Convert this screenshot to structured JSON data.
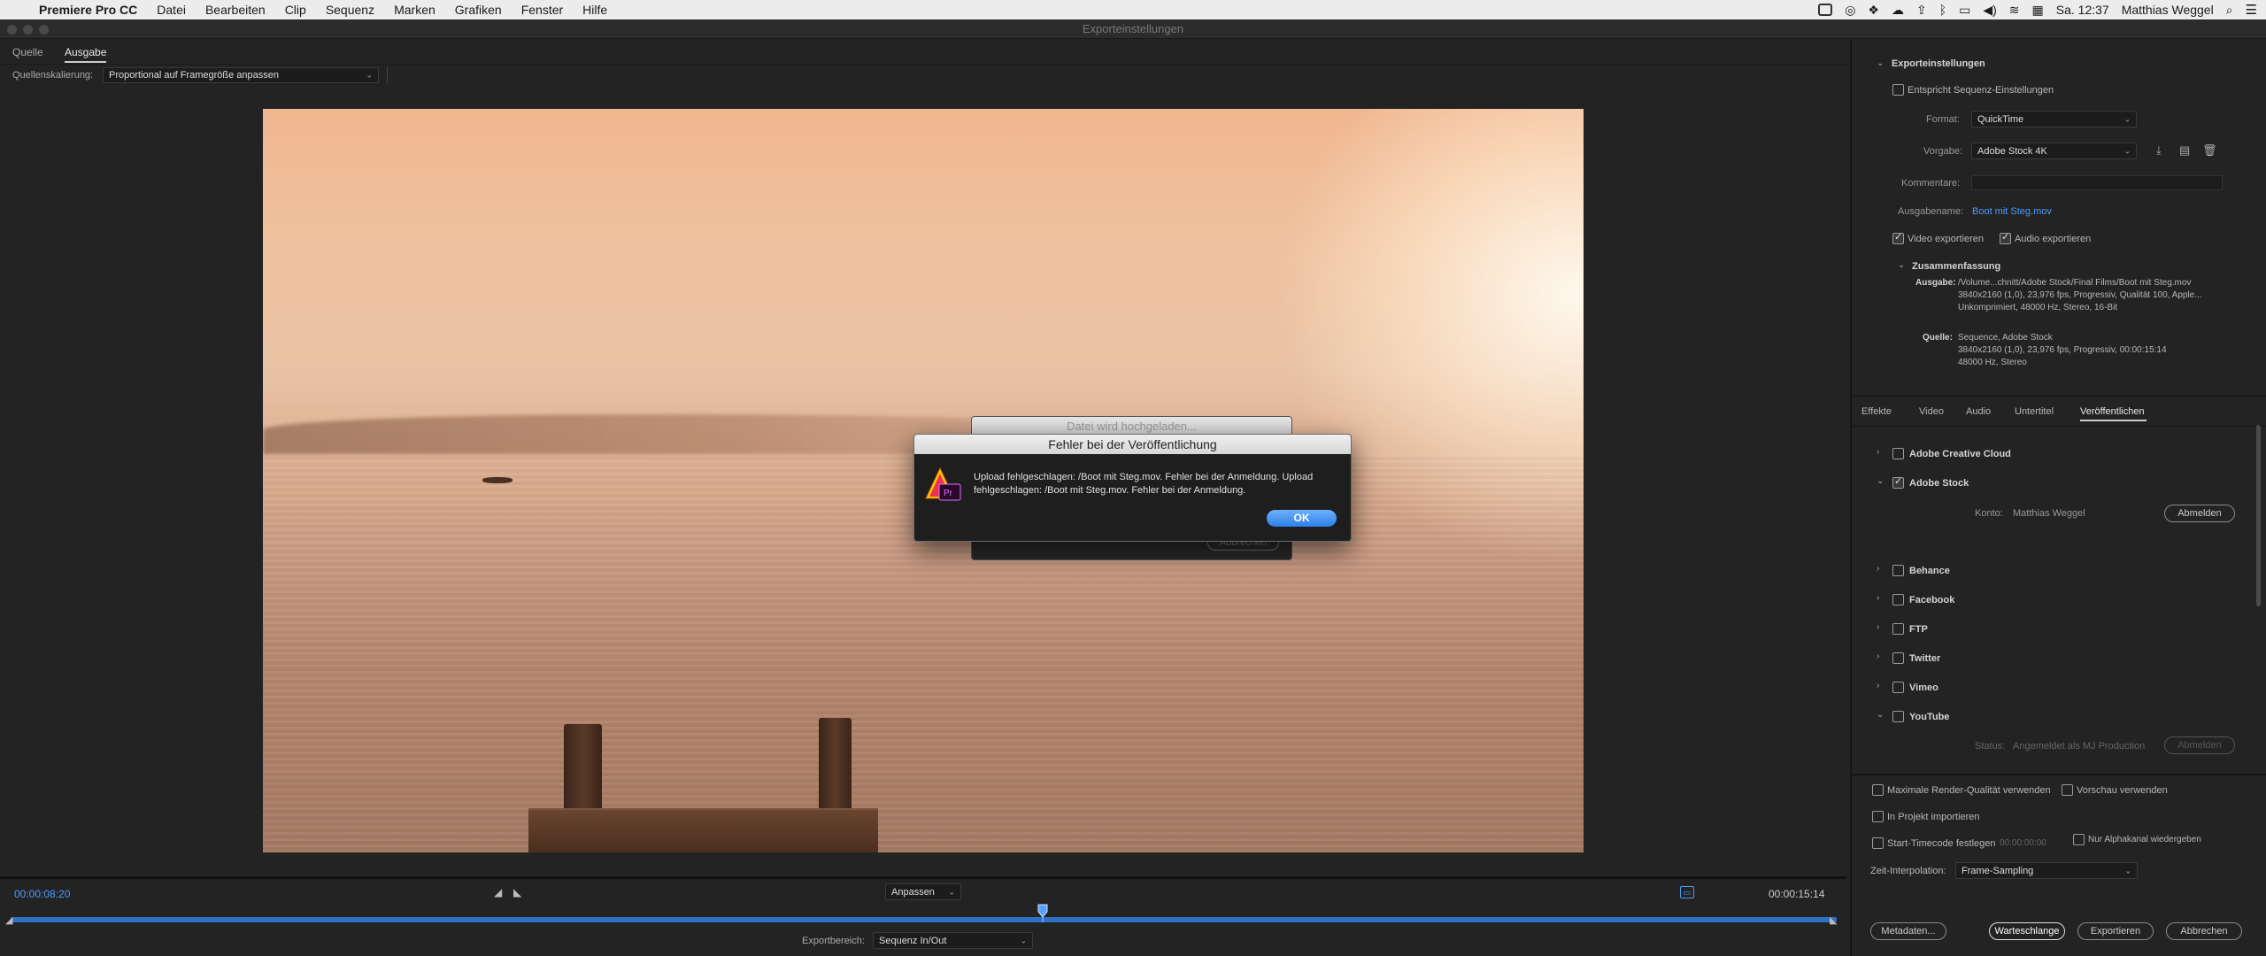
{
  "menubar": {
    "apple": "",
    "app": "Premiere Pro CC",
    "items": [
      "Datei",
      "Bearbeiten",
      "Clip",
      "Sequenz",
      "Marken",
      "Grafiken",
      "Fenster",
      "Hilfe"
    ],
    "clock": "Sa. 12:37",
    "user": "Matthias Weggel"
  },
  "window": {
    "title": "Exporteinstellungen"
  },
  "source_tabs": {
    "quelle": "Quelle",
    "ausgabe": "Ausgabe"
  },
  "scaling": {
    "label": "Quellenskalierung:",
    "value": "Proportional auf Framegröße anpassen"
  },
  "playback": {
    "current_time": "00:00:08:20",
    "end_time": "00:00:15:14",
    "fit": "Anpassen",
    "export_range_label": "Exportbereich:",
    "export_range_value": "Sequenz In/Out",
    "playhead_fraction": 0.565
  },
  "export_settings": {
    "section": "Exporteinstellungen",
    "match_sequence": "Entspricht Sequenz-Einstellungen",
    "format_label": "Format:",
    "format_value": "QuickTime",
    "preset_label": "Vorgabe:",
    "preset_value": "Adobe Stock 4K",
    "comments_label": "Kommentare:",
    "output_name_label": "Ausgabename:",
    "output_name_value": "Boot mit Steg.mov",
    "video_export": "Video exportieren",
    "audio_export": "Audio exportieren",
    "summary": "Zusammenfassung",
    "output_label": "Ausgabe:",
    "output_lines": [
      "/Volume...chnitt/Adobe Stock/Final Films/Boot mit Steg.mov",
      "3840x2160 (1,0), 23,976 fps, Progressiv, Qualität 100, Apple...",
      "Unkomprimiert, 48000 Hz, Stereo, 16-Bit"
    ],
    "source_label": "Quelle:",
    "source_lines": [
      "Sequence, Adobe Stock",
      "3840x2160 (1,0), 23,976 fps, Progressiv, 00:00:15:14",
      "48000 Hz, Stereo"
    ]
  },
  "panel_tabs": [
    "Effekte",
    "Video",
    "Audio",
    "Untertitel",
    "Veröffentlichen"
  ],
  "publish": {
    "creative_cloud": "Adobe Creative Cloud",
    "stock": "Adobe Stock",
    "account_label": "Konto:",
    "account_value": "Matthias Weggel",
    "logout": "Abmelden",
    "behance": "Behance",
    "facebook": "Facebook",
    "ftp": "FTP",
    "twitter": "Twitter",
    "vimeo": "Vimeo",
    "youtube": "YouTube",
    "status_label": "Status:",
    "status_value": "Angemeldet als MJ Production",
    "yt_logout": "Abmelden"
  },
  "options": {
    "max_render": "Maximale Render-Qualität verwenden",
    "use_preview": "Vorschau verwenden",
    "import_project": "In Projekt importieren",
    "start_timecode": "Start-Timecode festlegen",
    "start_timecode_value": "00:00:00:00",
    "alpha_only": "Nur Alphakanal wiedergeben",
    "time_interp_label": "Zeit-Interpolation:",
    "time_interp_value": "Frame-Sampling"
  },
  "buttons": {
    "metadata": "Metadaten...",
    "queue": "Warteschlange",
    "export": "Exportieren",
    "cancel": "Abbrechen"
  },
  "upload_dialog": {
    "title": "Datei wird hochgeladen...",
    "cancel": "Abbrechen"
  },
  "error_dialog": {
    "title": "Fehler bei der Veröffentlichung",
    "message": "Upload fehlgeschlagen: /Boot mit Steg.mov. Fehler bei der Anmeldung. Upload fehlgeschlagen: /Boot mit Steg.mov. Fehler bei der Anmeldung.",
    "ok": "OK",
    "icon_badge": "Pr"
  },
  "colors": {
    "accent": "#2f7fe8",
    "link": "#4d9bff",
    "timeline": "#2f6fc4"
  }
}
